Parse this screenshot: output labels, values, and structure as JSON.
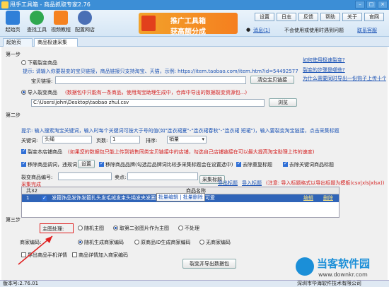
{
  "app": {
    "title": "甩手工具箱 - 商品抓取专家2.76",
    "version_label": "版本号:2.76.01",
    "company": "深圳市华海软件技术有限公司"
  },
  "toolbar": {
    "items": [
      {
        "label": "起始页",
        "color": "#2f7fd8"
      },
      {
        "label": "查找工具",
        "color": "#2fa84f"
      },
      {
        "label": "视频教程",
        "color": "#f58220"
      },
      {
        "label": "配置网店",
        "color": "#4a6fb5"
      }
    ],
    "banner": {
      "line1": "推广工具箱",
      "line2": "获高额分成"
    },
    "right_buttons": [
      "设置",
      "日志",
      "反馈",
      "帮助",
      "关于",
      "官网"
    ],
    "user": "消息(1)",
    "autologin": "不会使用或使用时遇到问题",
    "login": "联系客服"
  },
  "tabs": [
    {
      "label": "起始页"
    },
    {
      "label": "商品极速采集"
    }
  ],
  "step1": {
    "title": "第一步",
    "opt_download": "下载裂变商品",
    "tip_label": "提示:",
    "tip_text": "请输入你要裂变的宝贝链接，商品链接只支持淘宝、天猫，示例: https://item.taobao.com/item.htm?id=544925775455",
    "url_label": "宝贝链接:",
    "url_value": "",
    "clear_btn": "清空宝贝链接",
    "right_link1": "如何使用极速裂变?",
    "right_link2": "裂变的步骤是哪些?",
    "right_link3": "为什么需要同时导出一份钩子上传十个商品?",
    "opt_import": "导入裂变商品",
    "import_tip": "(数据包中只能有一条商品，使用淘宝助理生成中，仓库中导出的数据裂变资源包...)",
    "csv_path": "C:\\Users\\john\\Desktop\\taobao zhul.csv",
    "browse_btn": "浏览"
  },
  "step2": {
    "title": "第二步",
    "tip": "提示: 输入搜索淘宝关键词，输入时每个关键词可按大于号的值(如\"连衣裙夏\"-\"连衣裙春秋\"-\"连衣裙 短裙\")，输入要裂变淘宝链接，点击采集标题",
    "kw_label": "关键词:",
    "kw_value": "头绳",
    "page_label": "页数:",
    "page_value": "1",
    "sort_label": "排序:",
    "sort_value": "销量",
    "chk_fix_title": "裂变本店铺商品",
    "fix_tip": "(如果您的数据包只能上传到销售同类宝贝链接中的店铺，勾选自己店铺链接在可以最大提高淘宝助理上传的速度)",
    "chk_remove": "移除商品调词，违规词",
    "set_btn": "设置",
    "chk_brand": "移除商品品牌(勾选后品牌词比较多采集标题会在设置选中)",
    "chk_dup": "去除重复标题",
    "chk_all": "去除关键词商品标题",
    "split_label": "裂变商品编号:",
    "price_label": "卖点:",
    "collect_btn": "采集标题",
    "export_link": "导出标题",
    "import_link": "导入标题",
    "import_note": "(注意: 导入标题格式以导出标题为模板(csv|xls|xlsx))",
    "collected": "采集完成",
    "grid_headers": [
      "共32",
      "",
      "商品名称"
    ],
    "row": {
      "num": "1",
      "title": "发箍饰品发饰发箍扎头发毛绒发束头绳发夹发圈头饰发绳发绳头饰韩版可爱",
      "a1": "编辑",
      "a2": "删除"
    },
    "popup": "批量编辑 | 批量删除"
  },
  "step3": {
    "title": "第三步",
    "main_label": "主图处理:",
    "main_opts": [
      "随机主图",
      "取第二张图片作为主图",
      "不处理"
    ],
    "code_label": "商家编码:",
    "code_opts": [
      "随机生成商家编码",
      "原商品ID生成商家编码",
      "无商家编码"
    ],
    "chk_export_phone": "导出商品手机详情",
    "chk_add_code": "商品详情加入商家编码",
    "export_btn": "裂变并导出数据包"
  },
  "watermark": {
    "cn": "当客软件园",
    "url": "www.downkr.com"
  }
}
